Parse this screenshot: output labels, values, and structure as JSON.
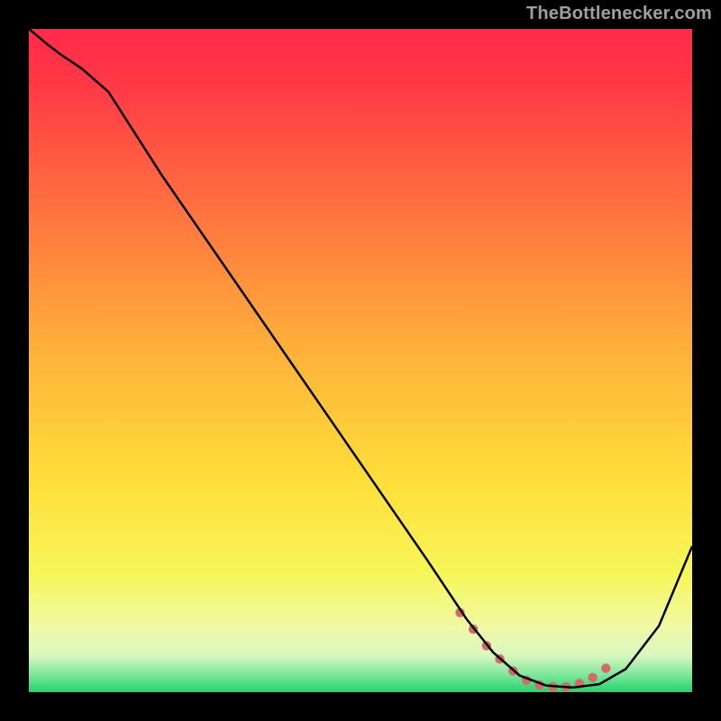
{
  "attribution": "TheBottlenecker.com",
  "chart_data": {
    "type": "line",
    "title": "",
    "xlabel": "",
    "ylabel": "",
    "xlim": [
      0,
      100
    ],
    "ylim": [
      0,
      100
    ],
    "gradient_stops": [
      {
        "offset": 0.0,
        "color": "#ff2a49"
      },
      {
        "offset": 0.08,
        "color": "#ff3846"
      },
      {
        "offset": 0.3,
        "color": "#ff7a3e"
      },
      {
        "offset": 0.5,
        "color": "#ffb53a"
      },
      {
        "offset": 0.68,
        "color": "#ffde3a"
      },
      {
        "offset": 0.82,
        "color": "#f7f658"
      },
      {
        "offset": 0.905,
        "color": "#f0f9a8"
      },
      {
        "offset": 0.945,
        "color": "#d8f7c0"
      },
      {
        "offset": 0.975,
        "color": "#7ae69a"
      },
      {
        "offset": 1.0,
        "color": "#23d36a"
      }
    ],
    "series": [
      {
        "name": "bottleneck-curve",
        "x": [
          0,
          3,
          5,
          8,
          12,
          20,
          30,
          40,
          50,
          60,
          66,
          70,
          74,
          78,
          82,
          86,
          90,
          95,
          100
        ],
        "y": [
          100,
          97.5,
          96,
          94,
          90.5,
          78,
          63.5,
          49,
          34.5,
          20,
          11,
          6,
          2.5,
          1,
          0.7,
          1.2,
          3.5,
          10,
          22
        ],
        "stroke": "#000000",
        "width": 2.5
      }
    ],
    "markers": {
      "name": "highlight-range",
      "x": [
        65,
        67,
        69,
        71,
        73,
        75,
        77,
        79,
        81,
        83,
        85,
        87
      ],
      "y": [
        12,
        9.5,
        7,
        5,
        3.2,
        1.8,
        1.1,
        0.8,
        0.8,
        1.3,
        2.2,
        3.6
      ],
      "color": "#d36a6a",
      "radius": 5.2
    }
  }
}
